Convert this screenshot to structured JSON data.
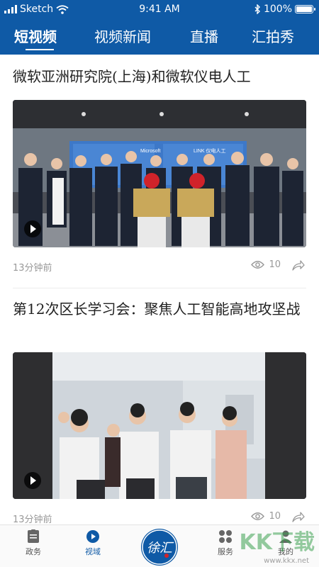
{
  "status_bar": {
    "carrier": "Sketch",
    "time": "9:41 AM",
    "battery": "100%",
    "battery_level": 1.0
  },
  "tabs": [
    {
      "label": "短视频",
      "active": true
    },
    {
      "label": "视频新闻",
      "active": false
    },
    {
      "label": "直播",
      "active": false
    },
    {
      "label": "汇拍秀",
      "active": false
    }
  ],
  "feed": [
    {
      "title": "微软亚洲研究院(上海)和微软仪电人工",
      "image_sign_left": "Microsoft",
      "image_sign_right": "LINK 仪电人工",
      "time": "13分钟前",
      "views": "10"
    },
    {
      "title": "第12次区长学习会：聚焦人工智能高地攻坚战",
      "time": "13分钟前",
      "views": "10"
    }
  ],
  "tabbar": {
    "items": [
      {
        "label": "政务",
        "icon": "document-icon"
      },
      {
        "label": "视域",
        "icon": "play-circle-icon",
        "active": true
      },
      {
        "label": "服务",
        "icon": "grid-icon"
      },
      {
        "label": "我的",
        "icon": "person-icon"
      }
    ],
    "center_logo_text": "徐汇"
  },
  "watermark": {
    "text": "KK下载",
    "url": "www.kkx.net"
  },
  "colors": {
    "brand_blue": "#0f5aa6",
    "meta_gray": "#999999"
  }
}
